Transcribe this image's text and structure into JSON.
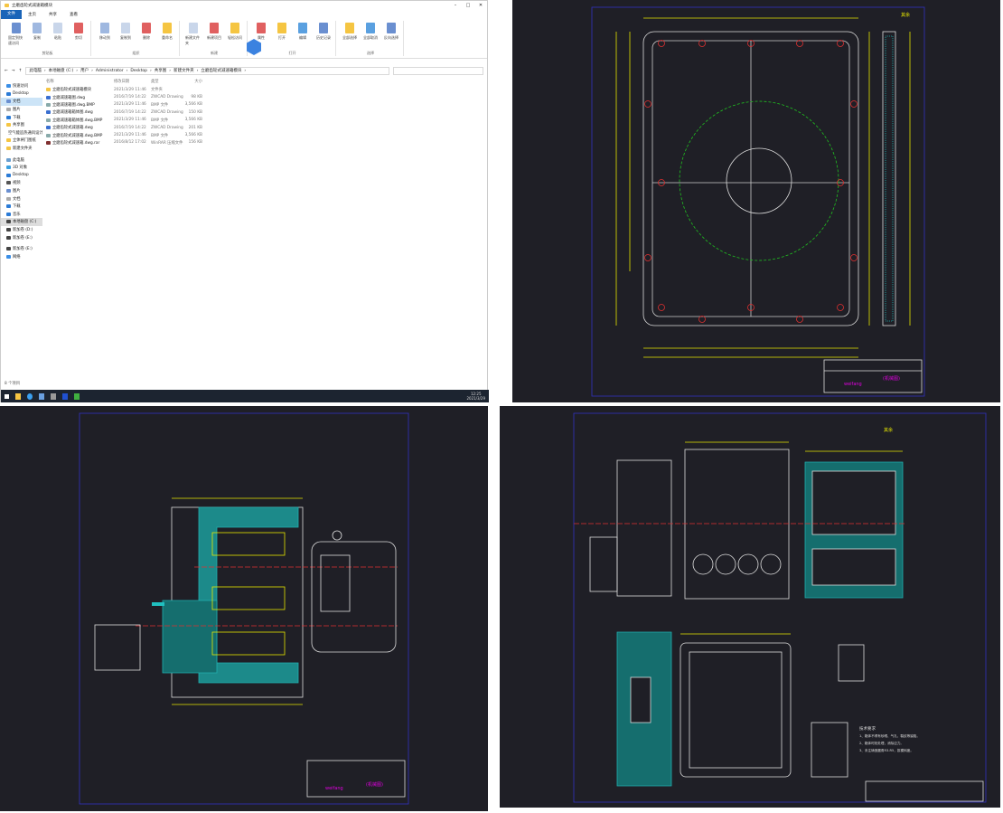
{
  "explorer": {
    "title": "立磨齿轮式减速箱模块",
    "menu_tabs": [
      "文件",
      "主页",
      "共享",
      "查看"
    ],
    "ribbon": {
      "groups": [
        {
          "name": "剪贴板",
          "buttons": [
            "固定到快速访问",
            "复制",
            "粘贴",
            "剪切"
          ]
        },
        {
          "name": "组织",
          "buttons": [
            "移动到",
            "复制到",
            "删除",
            "重命名"
          ]
        },
        {
          "name": "新建",
          "buttons": [
            "新建文件夹",
            "新建项目",
            "轻松访问"
          ]
        },
        {
          "name": "打开",
          "buttons": [
            "属性",
            "打开",
            "编辑",
            "历史记录"
          ]
        },
        {
          "name": "选择",
          "buttons": [
            "全部选择",
            "全部取消",
            "反向选择"
          ]
        }
      ]
    },
    "breadcrumb": [
      "此电脑",
      "本地磁盘 (C:)",
      "用户",
      "Administrator",
      "Desktop",
      "共享图",
      "新建文件夹",
      "立磨齿轮式减速箱模块"
    ],
    "nav": [
      "快速访问",
      "Desktop",
      "文档",
      "图片",
      "下载",
      "共享图",
      "空气能追热通风设计",
      "立体闸门图纸",
      "新建文件夹",
      "此电脑",
      "3D 对象",
      "Desktop",
      "视频",
      "图片",
      "文档",
      "下载",
      "音乐",
      "本地磁盘 (C:)",
      "新加卷 (D:)",
      "新加卷 (E:)",
      "新加卷 (E:)",
      "网络"
    ],
    "columns": [
      "名称",
      "修改日期",
      "类型",
      "大小"
    ],
    "files": [
      {
        "name": "立磨齿轮式减速箱模块",
        "date": "2021/3/29 11:46",
        "type": "文件夹",
        "size": "",
        "icon": "folder"
      },
      {
        "name": "立磨减速箱图.dwg",
        "date": "2016/7/19 14:22",
        "type": "ZWCAD Drawing",
        "size": "98 KB",
        "icon": "dwg"
      },
      {
        "name": "立磨减速箱图.dwg.BMP",
        "date": "2021/3/29 11:46",
        "type": "BMP 文件",
        "size": "3,566 KB",
        "icon": "bmp"
      },
      {
        "name": "立磨减速箱箱体图.dwg",
        "date": "2016/7/19 14:22",
        "type": "ZWCAD Drawing",
        "size": "150 KB",
        "icon": "dwg"
      },
      {
        "name": "立磨减速箱箱体图.dwg.BMP",
        "date": "2021/3/29 11:46",
        "type": "BMP 文件",
        "size": "3,566 KB",
        "icon": "bmp"
      },
      {
        "name": "立磨齿轮式减速箱.dwg",
        "date": "2016/7/19 14:22",
        "type": "ZWCAD Drawing",
        "size": "201 KB",
        "icon": "dwg"
      },
      {
        "name": "立磨齿轮式减速箱.dwg.BMP",
        "date": "2021/3/29 11:46",
        "type": "BMP 文件",
        "size": "3,566 KB",
        "icon": "bmp"
      },
      {
        "name": "立磨齿轮式减速箱.dwg.rar",
        "date": "2016/8/12 17:02",
        "type": "WinRAR 压缩文件",
        "size": "156 KB",
        "icon": "rar"
      }
    ],
    "status": "8 个项目",
    "clock_time": "12:25",
    "clock_date": "2021/3/29"
  },
  "drawings": {
    "title_block_name": "weifang",
    "title_block_mark": "(机械图)",
    "roughness_label": "其余",
    "tech_req_title": "技术要求",
    "tech_req": [
      "1、箱体不得有砂眼、气孔、裂纹等缺陷。",
      "2、箱体时效处理，消除应力。",
      "3、未注铸造圆角R3-R5，拔模斜度。"
    ]
  },
  "colors": {
    "cad_bg": "#1f1f26",
    "cad_yellow": "#e6e600",
    "cad_cyan": "#20b0b0",
    "cad_magenta": "#e000e0",
    "cad_red": "#e03030",
    "cad_green": "#20c020",
    "cad_border": "#3030c0",
    "accent": "#1a64b8"
  }
}
